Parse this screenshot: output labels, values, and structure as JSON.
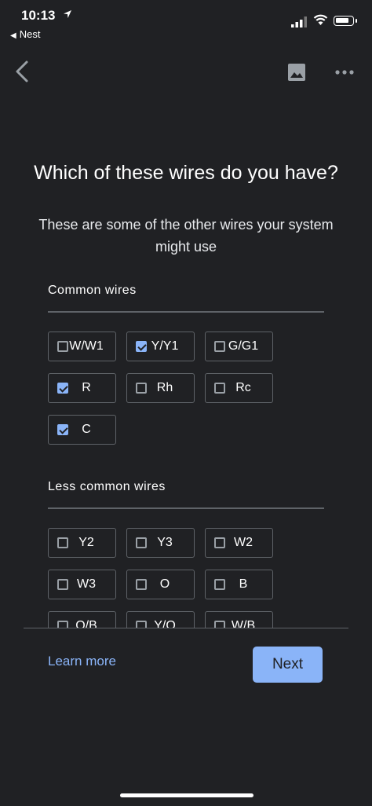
{
  "status_bar": {
    "time": "10:13",
    "back_app": "Nest"
  },
  "header": {
    "title": "Which of these wires do you have?",
    "subtitle": "These are some of the other wires your system might use"
  },
  "common": {
    "label": "Common wires",
    "wires": [
      {
        "label": "W/W1",
        "checked": false
      },
      {
        "label": "Y/Y1",
        "checked": true
      },
      {
        "label": "G/G1",
        "checked": false
      },
      {
        "label": "R",
        "checked": true
      },
      {
        "label": "Rh",
        "checked": false
      },
      {
        "label": "Rc",
        "checked": false
      },
      {
        "label": "C",
        "checked": true
      }
    ]
  },
  "less_common": {
    "label": "Less common wires",
    "wires": [
      {
        "label": "Y2",
        "checked": false
      },
      {
        "label": "Y3",
        "checked": false
      },
      {
        "label": "W2",
        "checked": false
      },
      {
        "label": "W3",
        "checked": false
      },
      {
        "label": "O",
        "checked": false
      },
      {
        "label": "B",
        "checked": false
      },
      {
        "label": "O/B",
        "checked": false
      },
      {
        "label": "Y/O",
        "checked": false
      },
      {
        "label": "W/B",
        "checked": false
      }
    ]
  },
  "footer": {
    "learn_more": "Learn more",
    "next": "Next"
  },
  "colors": {
    "background": "#202124",
    "accent": "#8ab4f8",
    "chip_border": "#5f6368"
  }
}
